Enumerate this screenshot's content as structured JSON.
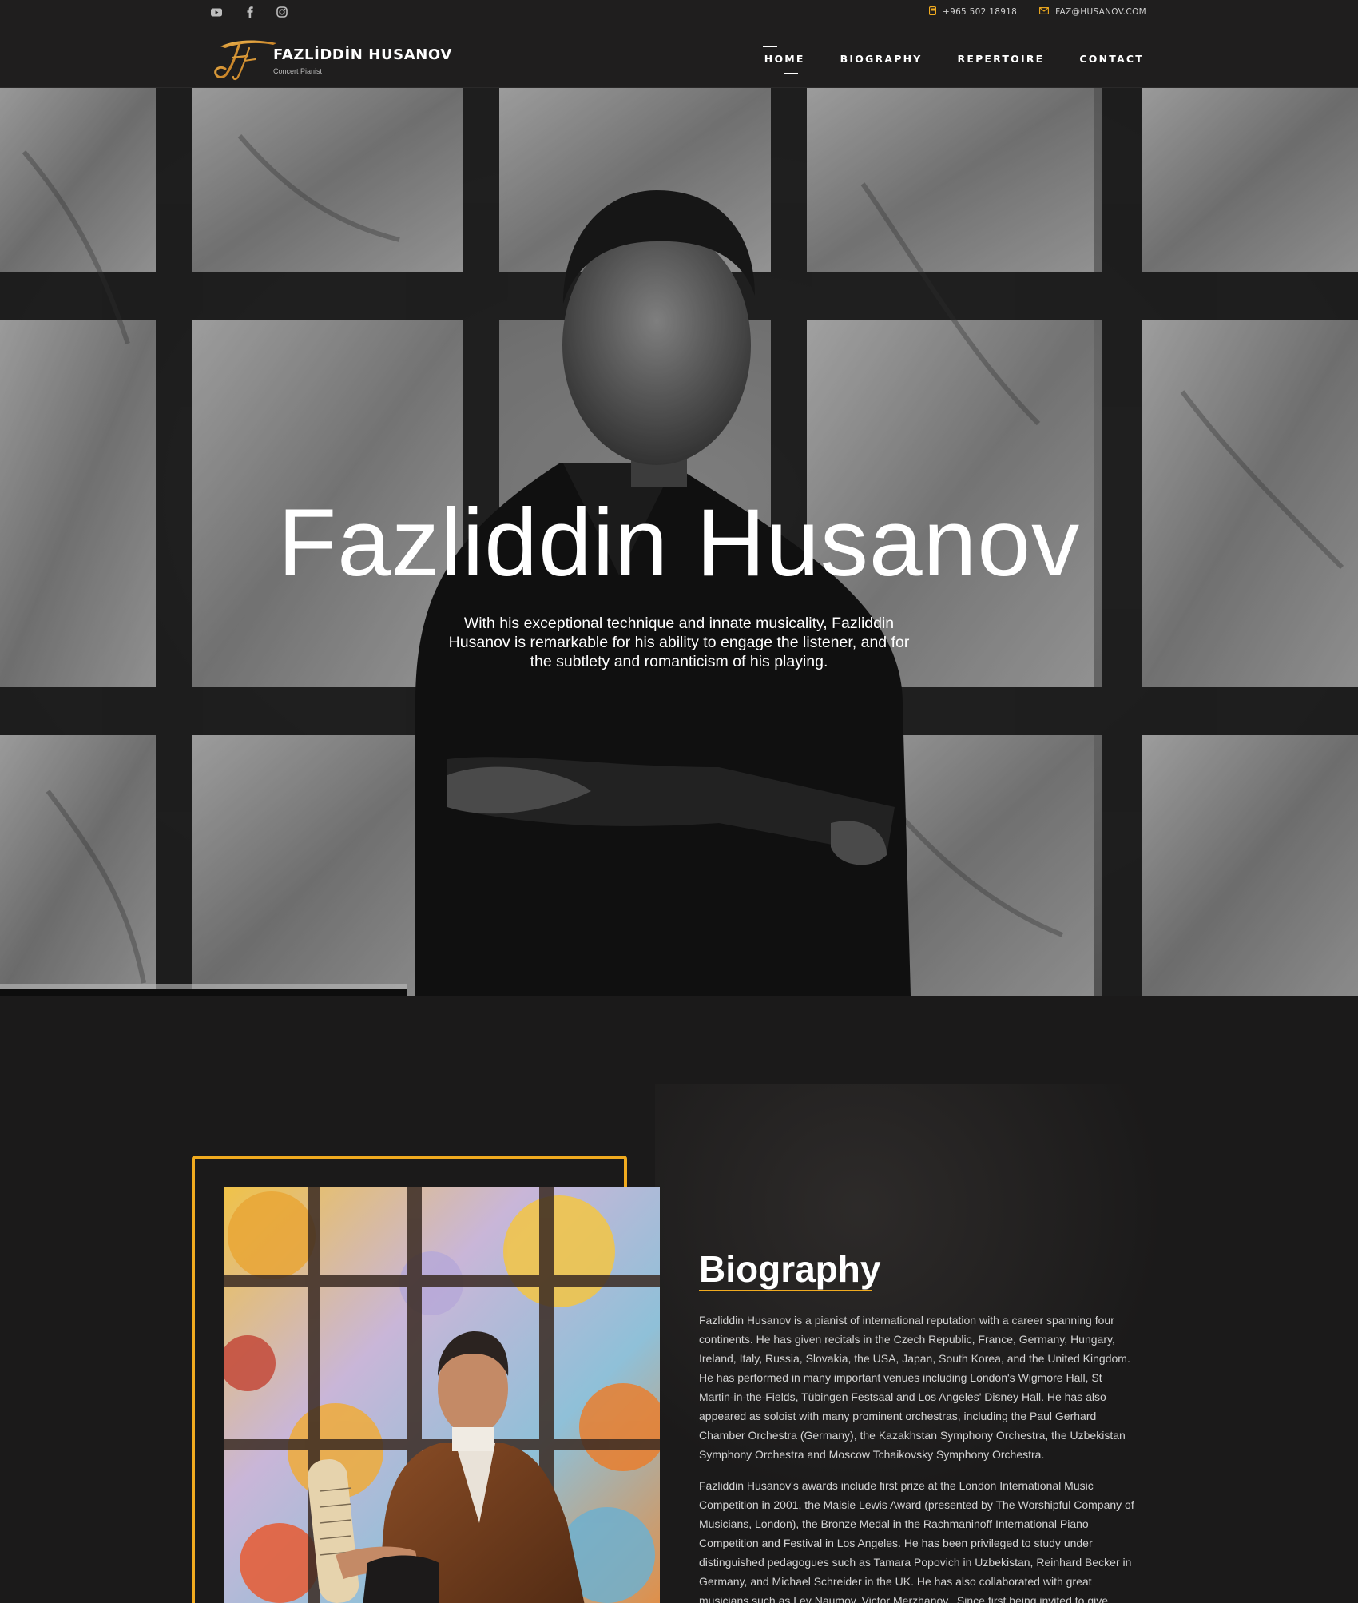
{
  "header": {
    "social_icons": [
      "youtube-icon",
      "facebook-icon",
      "instagram-icon"
    ],
    "phone": "+965 502 18918",
    "email": "FAZ@HUSANOV.COM",
    "logo_name": "FAZLİDDİN HUSANOV",
    "logo_subtitle": "Concert Pianist",
    "nav": [
      {
        "label": "HOME",
        "active": true
      },
      {
        "label": "BIOGRAPHY",
        "active": false
      },
      {
        "label": "REPERTOIRE",
        "active": false
      },
      {
        "label": "CONTACT",
        "active": false
      }
    ]
  },
  "hero": {
    "title": "Fazliddin Husanov",
    "subtitle": "With his exceptional technique and innate musicality, Fazliddin Husanov is remarkable for his ability to engage the listener, and for the subtlety and romanticism of his playing."
  },
  "biography": {
    "heading": "Biography",
    "paragraphs": [
      "Fazliddin Husanov is a pianist of international reputation with a career spanning four continents. He has given recitals in the Czech Republic, France, Germany, Hungary, Ireland, Italy, Russia, Slovakia, the USA, Japan, South Korea, and the United Kingdom. He has performed in many important venues including London's Wigmore Hall, St Martin-in-the-Fields, Tübingen Festsaal and Los Angeles' Disney Hall. He has also appeared as soloist with many prominent orchestras, including the Paul Gerhard Chamber Orchestra (Germany), the Kazakhstan Symphony Orchestra, the Uzbekistan Symphony Orchestra and Moscow Tchaikovsky Symphony Orchestra.",
      "Fazliddin Husanov's awards include first prize at the London International Music Competition in 2001, the Maisie Lewis Award (presented by The Worshipful Company of Musicians, London), the Bronze Medal in the Rachmaninoff International Piano Competition and Festival in Los Angeles. He has been privileged to study under distinguished pedagogues such as Tamara Popovich in Uzbekistan, Reinhard Becker in Germany, and Michael Schreider in the UK. He has also collaborated with great musicians such as Lev Naumov, Victor Merzhanov.. Since first being invited to give"
    ]
  },
  "colors": {
    "accent": "#f1ab1f",
    "background": "#1b1a1a",
    "header_bg": "#1f1e1e"
  }
}
